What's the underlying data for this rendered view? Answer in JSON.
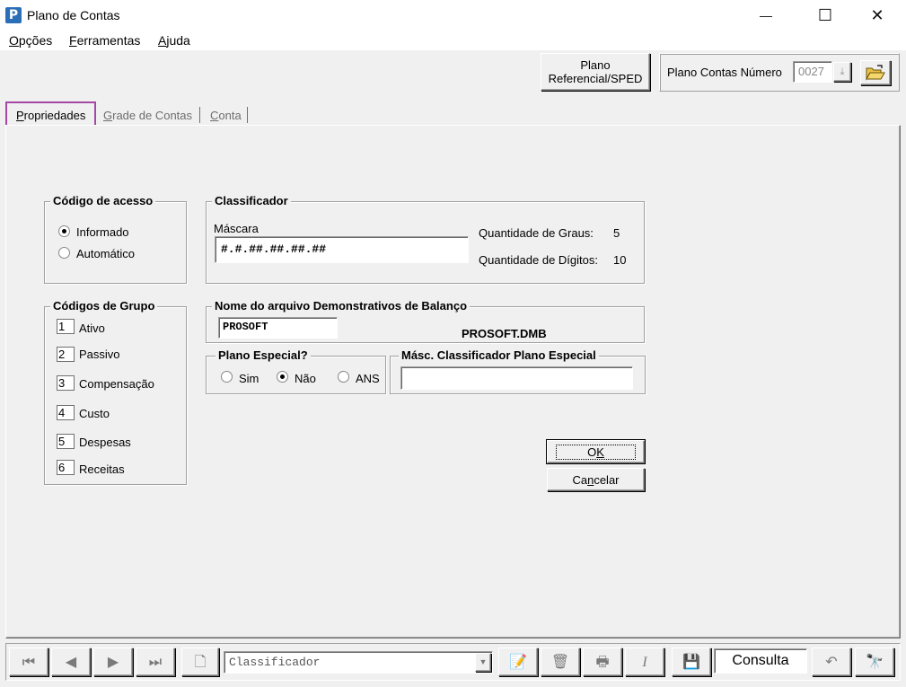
{
  "window": {
    "title": "Plano de Contas",
    "app_icon": "P",
    "controls": {
      "minimize": "—",
      "maximize": "☐",
      "close": "✕"
    }
  },
  "menu": [
    {
      "label": "Opções",
      "accel": "O",
      "rest": "pções"
    },
    {
      "label": "Ferramentas",
      "accel": "F",
      "rest": "erramentas"
    },
    {
      "label": "Ajuda",
      "accel": "A",
      "rest": "juda"
    }
  ],
  "toolbar": {
    "plano_ref_line1": "Plano",
    "plano_ref_line2": "Referencial/SPED",
    "plano_numero_label": "Plano Contas Número",
    "plano_numero_value": "0027"
  },
  "tabs": [
    {
      "label": "Propriedades",
      "accel": "P",
      "rest": "ropriedades",
      "active": true
    },
    {
      "label": "Grade de Contas",
      "accel": "G",
      "rest": "rade de Contas",
      "active": false
    },
    {
      "label": "Conta",
      "accel": "C",
      "rest": "onta",
      "active": false
    }
  ],
  "codigo_acesso": {
    "title": "Código de acesso",
    "options": [
      {
        "label": "Informado",
        "selected": true
      },
      {
        "label": "Automático",
        "selected": false
      }
    ]
  },
  "classificador": {
    "title": "Classificador",
    "mascara_label": "Máscara",
    "mascara_value": "#.#.##.##.##.##",
    "graus_label": "Quantidade de Graus:",
    "graus_value": "5",
    "digitos_label": "Quantidade de Dígitos:",
    "digitos_value": "10"
  },
  "codigos_grupo": {
    "title": "Códigos de Grupo",
    "items": [
      {
        "code": "1",
        "label": "Ativo"
      },
      {
        "code": "2",
        "label": "Passivo"
      },
      {
        "code": "3",
        "label": "Compensação"
      },
      {
        "code": "4",
        "label": "Custo"
      },
      {
        "code": "5",
        "label": "Despesas"
      },
      {
        "code": "6",
        "label": "Receitas"
      }
    ]
  },
  "arquivo_balanco": {
    "title": "Nome do arquivo Demonstrativos de Balanço",
    "input_value": "PROSOFT",
    "filename": "PROSOFT.DMB"
  },
  "plano_especial": {
    "title": "Plano Especial?",
    "options": [
      {
        "label": "Sim",
        "selected": false
      },
      {
        "label": "Não",
        "selected": true
      },
      {
        "label": "ANS",
        "selected": false
      }
    ]
  },
  "masc_especial": {
    "title": "Másc. Classificador Plano Especial",
    "value": ""
  },
  "actions": {
    "ok_label": "OK",
    "ok_accel": "K",
    "cancel_label": "Cancelar",
    "cancel_accel": "n"
  },
  "navbar": {
    "search_value": "Classificador",
    "mode_label": "Consulta",
    "icons": [
      "first-record-icon",
      "prev-record-icon",
      "next-record-icon",
      "last-record-icon",
      "new-record-icon",
      "edit-icon",
      "delete-icon",
      "print-icon",
      "italic-icon",
      "save-icon",
      "undo-icon",
      "find-icon"
    ]
  },
  "colors": {
    "tab_highlight": "#a349a4",
    "app_icon_bg": "#2a6fb8"
  }
}
